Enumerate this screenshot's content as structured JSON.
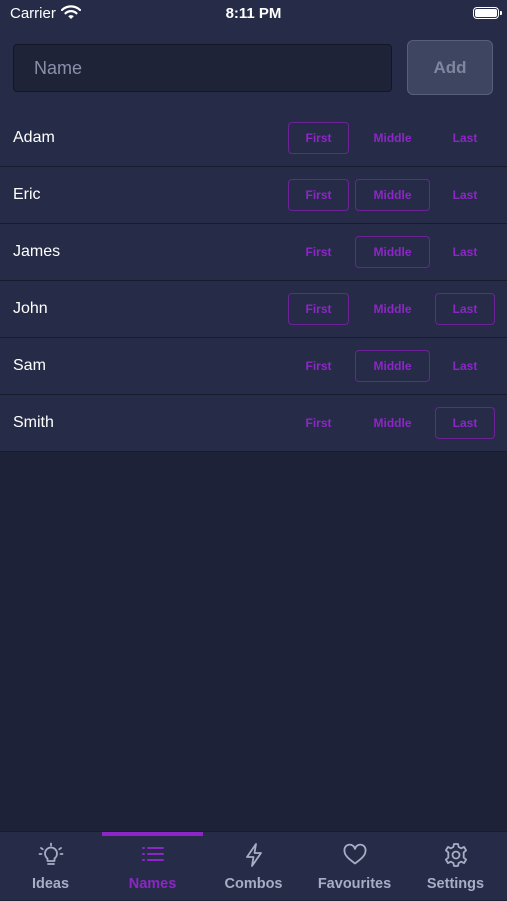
{
  "status": {
    "carrier": "Carrier",
    "time": "8:11 PM"
  },
  "input": {
    "placeholder": "Name",
    "value": ""
  },
  "add_label": "Add",
  "rows": [
    {
      "name": "Adam",
      "first": "First",
      "middle": "Middle",
      "last": "Last",
      "selected": [
        "first"
      ]
    },
    {
      "name": "Eric",
      "first": "First",
      "middle": "Middle",
      "last": "Last",
      "selected": [
        "first",
        "middle"
      ]
    },
    {
      "name": "James",
      "first": "First",
      "middle": "Middle",
      "last": "Last",
      "selected": [
        "middle"
      ]
    },
    {
      "name": "John",
      "first": "First",
      "middle": "Middle",
      "last": "Last",
      "selected": [
        "first",
        "last"
      ]
    },
    {
      "name": "Sam",
      "first": "First",
      "middle": "Middle",
      "last": "Last",
      "selected": [
        "middle"
      ]
    },
    {
      "name": "Smith",
      "first": "First",
      "middle": "Middle",
      "last": "Last",
      "selected": [
        "last"
      ]
    }
  ],
  "tabs": [
    {
      "label": "Ideas",
      "icon": "lightbulb-icon",
      "active": false
    },
    {
      "label": "Names",
      "icon": "list-icon",
      "active": true
    },
    {
      "label": "Combos",
      "icon": "lightning-icon",
      "active": false
    },
    {
      "label": "Favourites",
      "icon": "heart-icon",
      "active": false
    },
    {
      "label": "Settings",
      "icon": "gear-icon",
      "active": false
    }
  ],
  "colors": {
    "accent": "#8c26c6",
    "background": "#1d2239",
    "surface": "#262c47"
  }
}
